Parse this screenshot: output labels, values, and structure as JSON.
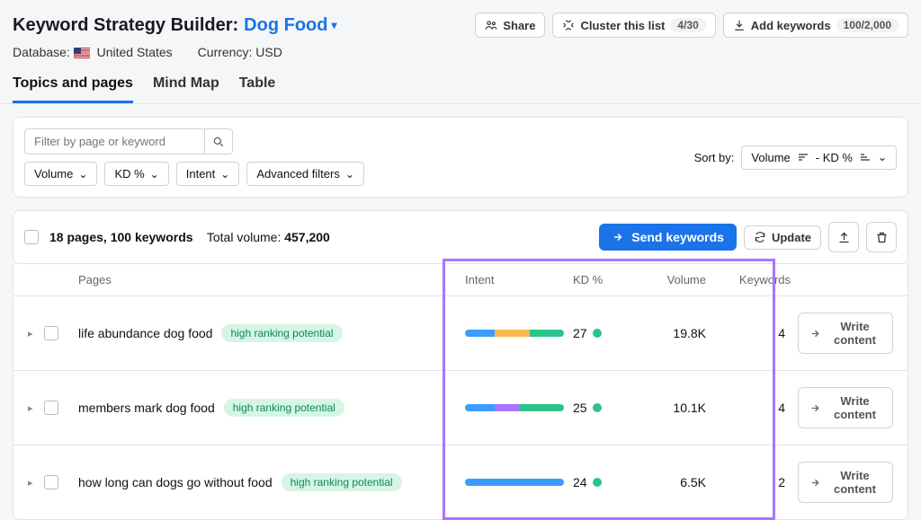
{
  "header": {
    "title_prefix": "Keyword Strategy Builder:",
    "title_link": "Dog Food",
    "database_label": "Database:",
    "database_value": "United States",
    "currency_label": "Currency:",
    "currency_value": "USD",
    "share_label": "Share",
    "cluster_label": "Cluster this list",
    "cluster_badge": "4/30",
    "add_kw_label": "Add keywords",
    "add_kw_badge": "100/2,000"
  },
  "tabs": [
    "Topics and pages",
    "Mind Map",
    "Table"
  ],
  "filters": {
    "search_placeholder": "Filter by page or keyword",
    "volume": "Volume",
    "kd": "KD %",
    "intent": "Intent",
    "advanced": "Advanced filters",
    "sort_label": "Sort by:",
    "sort_primary": "Volume",
    "sort_secondary": "- KD %"
  },
  "summary": {
    "pages_kw": "18 pages, 100 keywords",
    "total_label": "Total volume:",
    "total_value": "457,200",
    "send_label": "Send keywords",
    "update_label": "Update"
  },
  "columns": {
    "pages": "Pages",
    "intent": "Intent",
    "kd": "KD %",
    "volume": "Volume",
    "keywords": "Keywords"
  },
  "row_actions": {
    "write": "Write content"
  },
  "rows": [
    {
      "page": "life abundance dog food",
      "tag": "high ranking potential",
      "intent_segments": [
        {
          "color": "#3b9cff",
          "pct": 30
        },
        {
          "color": "#f6b94b",
          "pct": 35
        },
        {
          "color": "#2bc48a",
          "pct": 35
        }
      ],
      "kd": "27",
      "volume": "19.8K",
      "kw": "4"
    },
    {
      "page": "members mark dog food",
      "tag": "high ranking potential",
      "intent_segments": [
        {
          "color": "#3b9cff",
          "pct": 30
        },
        {
          "color": "#a974ff",
          "pct": 25
        },
        {
          "color": "#2bc48a",
          "pct": 45
        }
      ],
      "kd": "25",
      "volume": "10.1K",
      "kw": "4"
    },
    {
      "page": "how long can dogs go without food",
      "tag": "high ranking potential",
      "intent_segments": [
        {
          "color": "#3b9cff",
          "pct": 100
        }
      ],
      "kd": "24",
      "volume": "6.5K",
      "kw": "2"
    }
  ]
}
